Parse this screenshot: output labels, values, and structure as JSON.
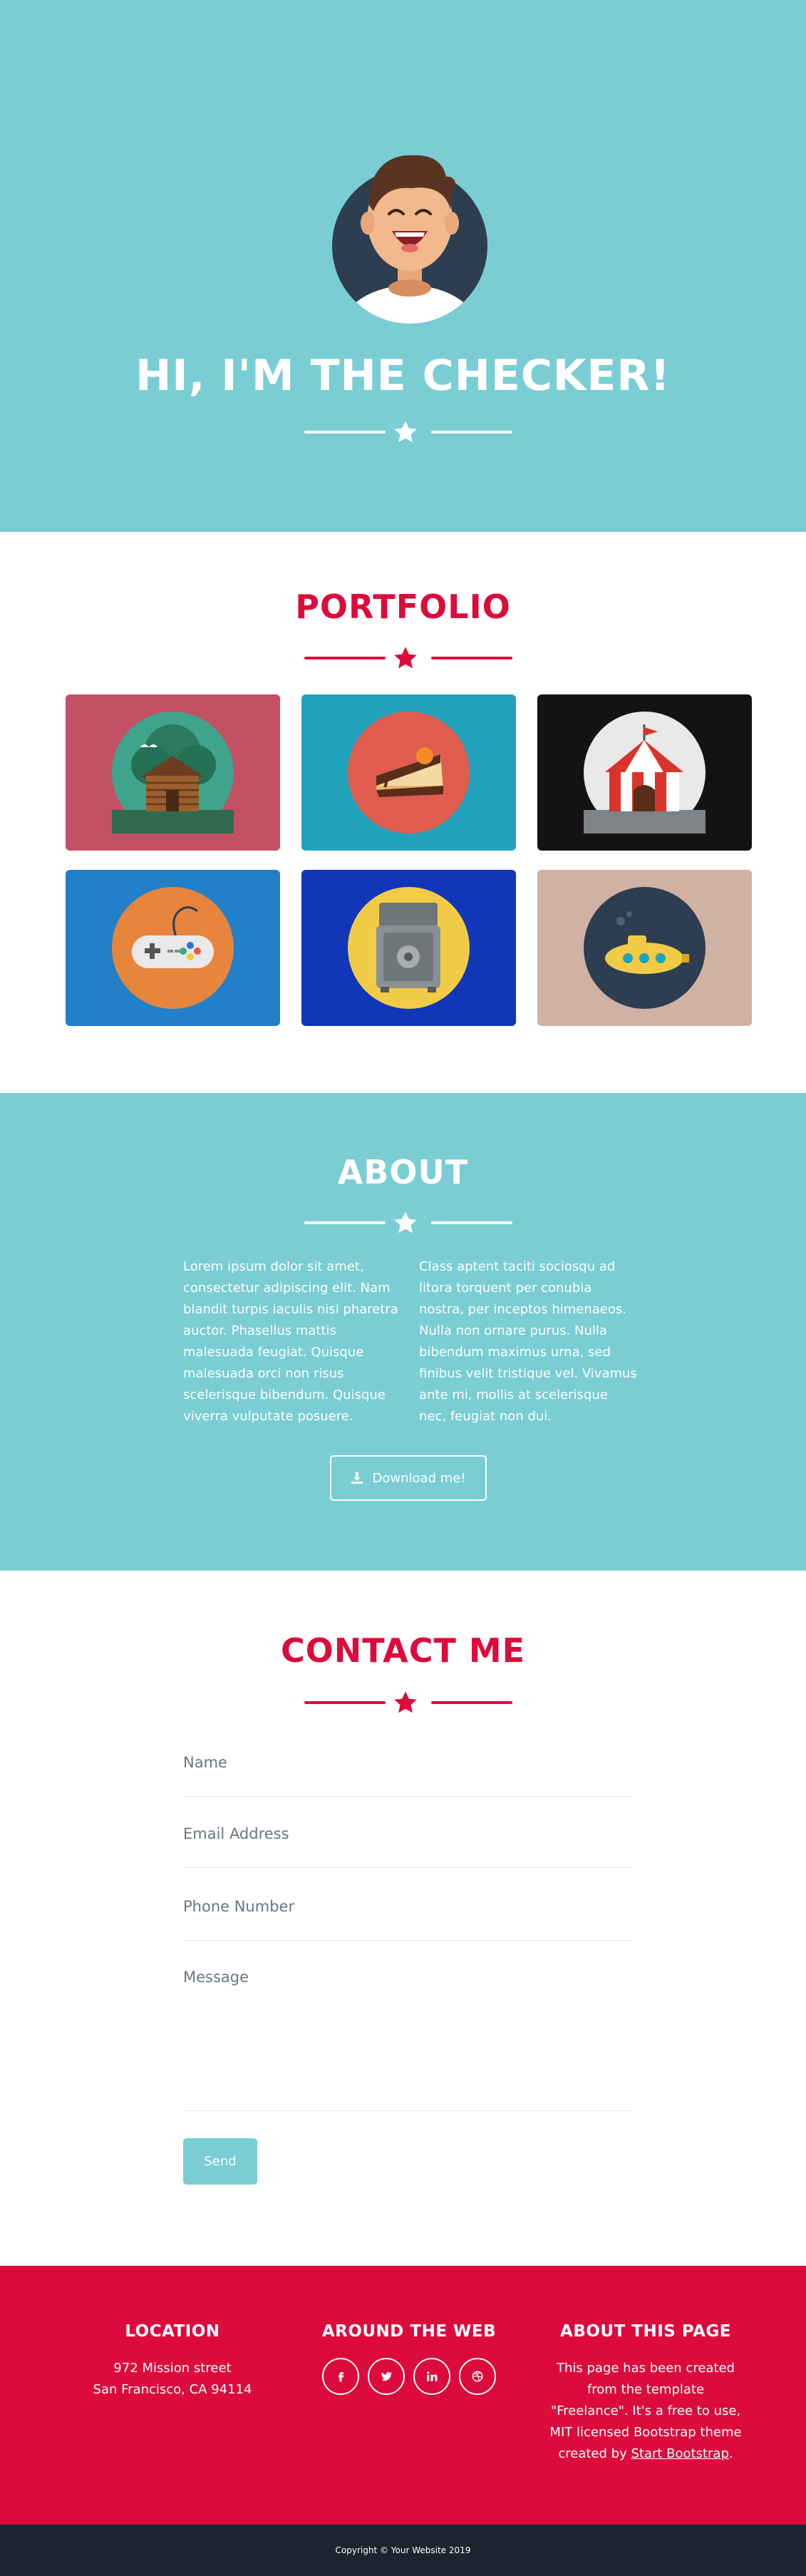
{
  "masthead": {
    "title": "HI, I'M THE CHECKER!",
    "background": "#79cdd3"
  },
  "portfolio": {
    "title": "PORTFOLIO",
    "items": [
      {
        "name": "cabin",
        "card_color": "#c35063",
        "disc_color": "#3fa48b"
      },
      {
        "name": "cake",
        "card_color": "#22a2ba",
        "disc_color": "#e05d4f"
      },
      {
        "name": "circus",
        "card_color": "#141212",
        "disc_color": "#e9e9e9"
      },
      {
        "name": "game-controller",
        "card_color": "#2180c9",
        "disc_color": "#e8853c"
      },
      {
        "name": "safe",
        "card_color": "#1136b8",
        "disc_color": "#f2cb46"
      },
      {
        "name": "submarine",
        "card_color": "#cfb2a4",
        "disc_color": "#2c3e50"
      }
    ]
  },
  "about": {
    "title": "ABOUT",
    "paragraph_left": "Lorem ipsum dolor sit amet, consectetur adipiscing elit. Nam blandit turpis iaculis nisi pharetra auctor. Phasellus mattis malesuada feugiat. Quisque malesuada orci non risus scelerisque bibendum. Quisque viverra vulputate posuere.",
    "paragraph_right": "Class aptent taciti sociosqu ad litora torquent per conubia nostra, per inceptos himenaeos. Nulla non ornare purus. Nulla bibendum maximus urna, sed finibus velit tristique vel. Vivamus ante mi, mollis at scelerisque nec, feugiat non dui.",
    "download_label": "Download me!"
  },
  "contact": {
    "title": "CONTACT ME",
    "name_placeholder": "Name",
    "email_placeholder": "Email Address",
    "phone_placeholder": "Phone Number",
    "message_placeholder": "Message",
    "send_label": "Send"
  },
  "footer": {
    "location_title": "LOCATION",
    "address_line1": "972 Mission street",
    "address_line2": "San Francisco, CA 94114",
    "web_title": "AROUND THE WEB",
    "social": [
      "f",
      "t",
      "in",
      "dribbble"
    ],
    "about_title": "ABOUT THIS PAGE",
    "about_text": "This page has been created from the template \"Freelance\". It's a free to use, MIT licensed Bootstrap theme created by",
    "about_link": "Start Bootstrap",
    "about_end": "."
  },
  "copyright": "Copyright © Your Website 2019",
  "colors": {
    "teal": "#79cdd3",
    "brand_red": "#dc0b3c",
    "dark": "#1a252f"
  }
}
